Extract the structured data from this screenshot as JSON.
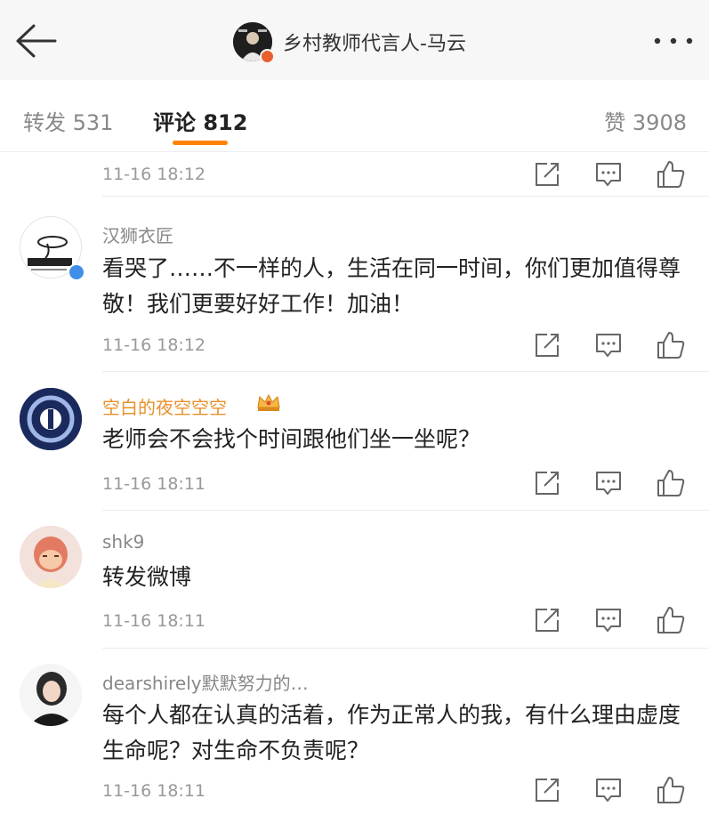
{
  "header": {
    "title": "乡村教师代言人-马云",
    "back_icon": "arrow-left-icon",
    "more_icon": "more-dots-icon"
  },
  "tabs": {
    "repost": "转发 531",
    "comment": "评论 812",
    "likes": "赞 3908",
    "accent_color": "#ff8200"
  },
  "comments": [
    {
      "time": "11-16 18:12"
    },
    {
      "user": "汉狮衣匠",
      "text": "看哭了……不一样的人，生活在同一时间，你们更加值得尊敬！我们更要好好工作！加油！",
      "time": "11-16 18:12",
      "verified": true
    },
    {
      "user": "空白的夜空空空",
      "text": "老师会不会找个时间跟他们坐一坐呢？",
      "time": "11-16 18:11",
      "user_color": "#e8902c",
      "badge": "crown-icon"
    },
    {
      "user": "shk9",
      "text": "转发微博",
      "time": "11-16 18:11"
    },
    {
      "user": "dearshirely默默努力的…",
      "text": "每个人都在认真的活着，作为正常人的我，有什么理由虚度生命呢？对生命不负责呢？",
      "time": "11-16 18:11"
    }
  ],
  "action_icons": [
    "share-icon",
    "comment-icon",
    "like-icon"
  ]
}
